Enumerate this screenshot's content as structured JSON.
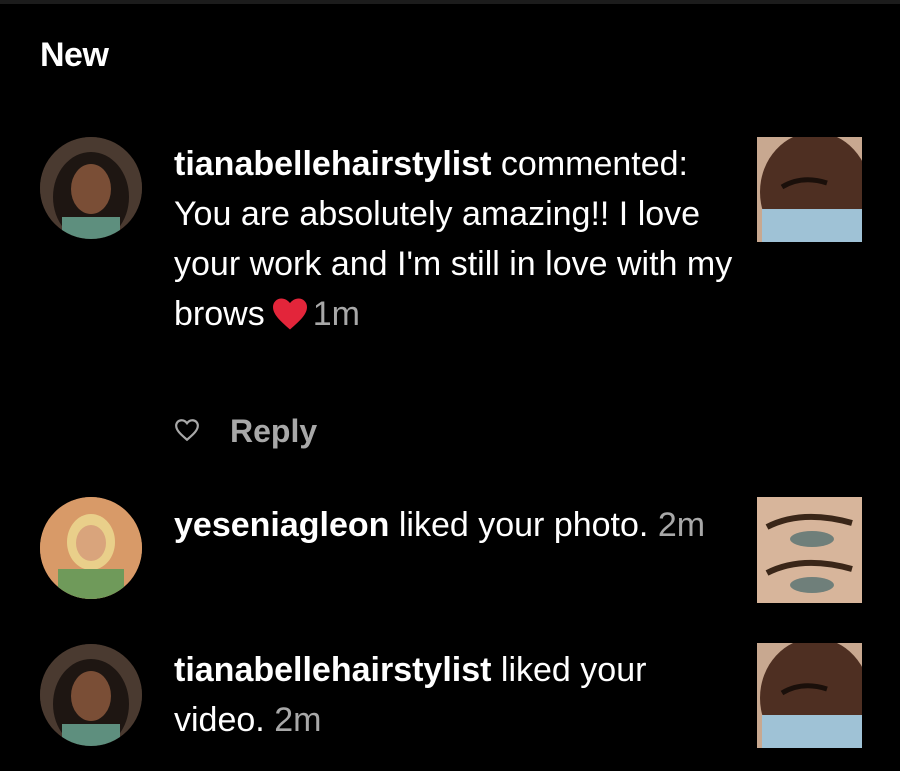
{
  "section": {
    "title": "New"
  },
  "notifications": [
    {
      "username": "tianabellehairstylist",
      "action": " commented: You are absolutely amazing!! I love your work and I'm still in love with my brows",
      "emoji": "red-heart-emoji",
      "time": "1m",
      "reply_label": "Reply",
      "avatar_icon": "user-avatar",
      "thumbnail": "post-thumbnail-eyebrows"
    },
    {
      "username": "yeseniagleon",
      "action": " liked your photo.",
      "time": "2m",
      "avatar_icon": "user-avatar",
      "thumbnail": "post-thumbnail-eyebrows"
    },
    {
      "username": "tianabellehairstylist",
      "action": " liked your video.",
      "time": "2m",
      "avatar_icon": "user-avatar",
      "thumbnail": "post-thumbnail-eyebrows"
    }
  ],
  "colors": {
    "background": "#000000",
    "text": "#ffffff",
    "secondary_text": "#a8a8a8",
    "heart": "#e3253a"
  }
}
